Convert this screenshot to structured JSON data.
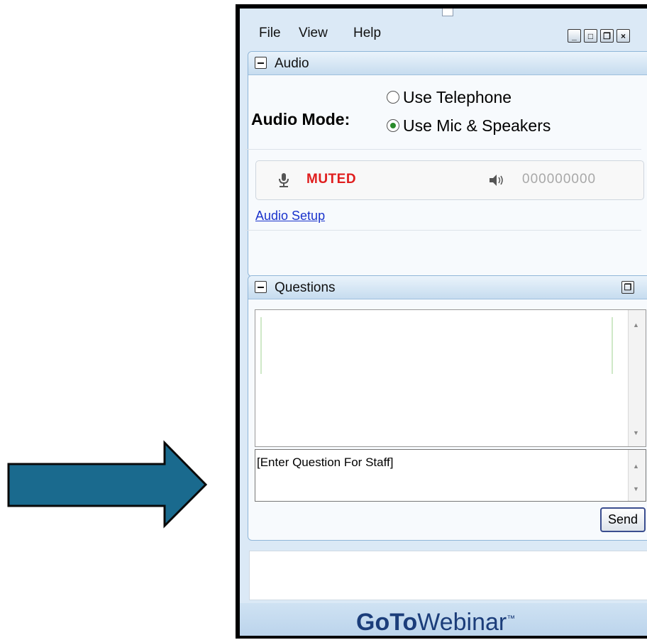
{
  "menu": {
    "file": "File",
    "view": "View",
    "help": "Help"
  },
  "window_buttons": {
    "minimize": "_",
    "maximize": "□",
    "restore": "❐",
    "close": "×"
  },
  "audio": {
    "title": "Audio",
    "mode_label": "Audio Mode:",
    "options": [
      "Use Telephone",
      "Use Mic & Speakers"
    ],
    "selected_option": "Use Mic & Speakers",
    "mic_status": "MUTED",
    "speaker_level": "000000000",
    "setup_link": "Audio Setup"
  },
  "questions": {
    "title": "Questions",
    "input_placeholder": "[Enter Question For Staff]",
    "send_label": "Send"
  },
  "brand": {
    "go": "Go",
    "to": "To",
    "webinar": "Webinar",
    "tm": "™"
  },
  "colors": {
    "arrow": "#1a6a8e",
    "muted": "#e01d1d",
    "link": "#1a33cc",
    "brand": "#1b3d7a"
  }
}
